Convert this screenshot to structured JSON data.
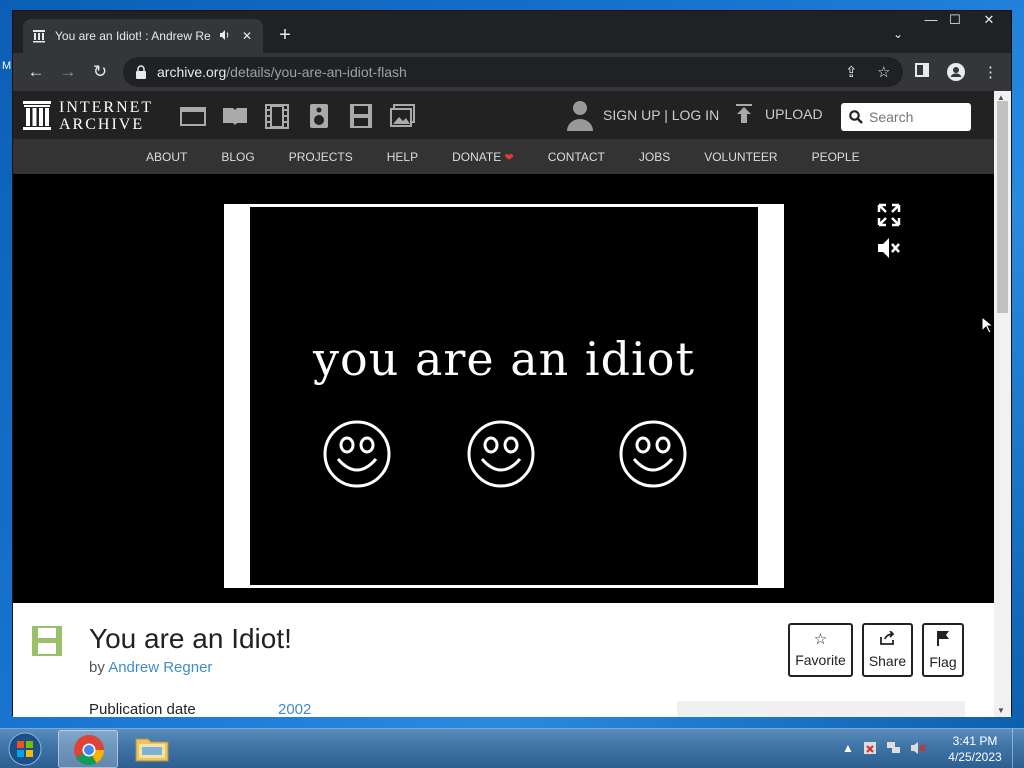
{
  "desktop": {
    "edge_letter": "M"
  },
  "browser": {
    "tab": {
      "title": "You are an Idiot! : Andrew Re",
      "audio_icon": "speaker-icon",
      "close_icon": "close-icon"
    },
    "new_tab_label": "+",
    "window_controls": {
      "minimize": "—",
      "maximize": "☐",
      "close": "✕"
    },
    "address": {
      "host": "archive.org",
      "path": "/details/you-are-an-idiot-flash"
    }
  },
  "ia": {
    "logo_line1": "INTERNET",
    "logo_line2": "ARCHIVE",
    "account": "SIGN UP | LOG IN",
    "upload": "UPLOAD",
    "search_placeholder": "Search",
    "nav": [
      "ABOUT",
      "BLOG",
      "PROJECTS",
      "HELP",
      "DONATE",
      "CONTACT",
      "JOBS",
      "VOLUNTEER",
      "PEOPLE"
    ]
  },
  "player": {
    "text": "you are an idiot"
  },
  "item": {
    "title": "You are an Idiot!",
    "by_prefix": "by",
    "author": "Andrew Regner",
    "pub_label": "Publication date",
    "pub_value": "2002",
    "actions": {
      "favorite": "Favorite",
      "share": "Share",
      "flag": "Flag"
    }
  },
  "taskbar": {
    "time": "3:41 PM",
    "date": "4/25/2023"
  },
  "colors": {
    "ia_link": "#428bca",
    "ia_header": "#222222",
    "ia_nav": "#333333",
    "donate_heart": "#e53935"
  }
}
